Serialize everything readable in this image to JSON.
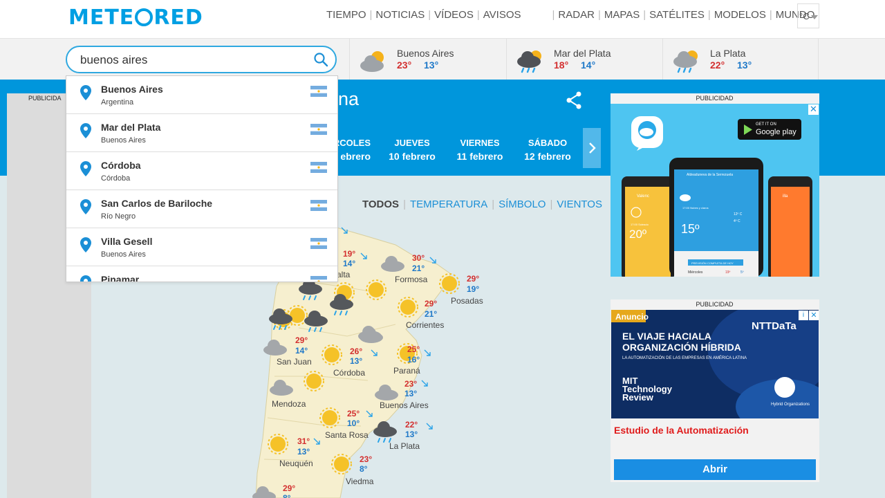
{
  "header": {
    "logo_text": "METEORED",
    "nav": [
      "TIEMPO",
      "NOTICIAS",
      "VÍDEOS",
      "AVISOS",
      "RADAR",
      "MAPAS",
      "SATÉLITES",
      "MODELOS",
      "MUNDO"
    ],
    "unit": "°C"
  },
  "search": {
    "value": "buenos aires"
  },
  "quick_cities": [
    {
      "name": "Buenos Aires",
      "max": "23°",
      "min": "13°",
      "icon": "partly-cloudy-icon"
    },
    {
      "name": "Mar del Plata",
      "max": "18°",
      "min": "14°",
      "icon": "rain-cloud-icon"
    },
    {
      "name": "La Plata",
      "max": "22°",
      "min": "13°",
      "icon": "rain-cloud-icon"
    }
  ],
  "band": {
    "title_fragment": "na",
    "days": [
      {
        "name": "RCOLES",
        "date": "ebrero"
      },
      {
        "name": "JUEVES",
        "date": "10 febrero"
      },
      {
        "name": "VIERNES",
        "date": "11 febrero"
      },
      {
        "name": "SÁBADO",
        "date": "12 febrero"
      }
    ]
  },
  "left_ad_label": "PUBLICIDA",
  "suggestions": [
    {
      "city": "Buenos Aires",
      "region": "Argentina"
    },
    {
      "city": "Mar del Plata",
      "region": "Buenos Aires"
    },
    {
      "city": "Córdoba",
      "region": "Córdoba"
    },
    {
      "city": "San Carlos de Bariloche",
      "region": "Río Negro"
    },
    {
      "city": "Villa Gesell",
      "region": "Buenos Aires"
    },
    {
      "city": "Pinamar",
      "region": ""
    }
  ],
  "filters": [
    "TODOS",
    "TEMPERATURA",
    "SÍMBOLO",
    "VIENTOS"
  ],
  "map_cities": [
    {
      "name": "alta",
      "max": "19°",
      "min": "14°"
    },
    {
      "name": "Formosa",
      "max": "30°",
      "min": "21°"
    },
    {
      "name": "Posadas",
      "max": "29°",
      "min": "19°"
    },
    {
      "name": "Corrientes",
      "max": "29°",
      "min": "21°"
    },
    {
      "name": "San Juan",
      "max": "29°",
      "min": "14°"
    },
    {
      "name": "Córdoba",
      "max": "26°",
      "min": "13°"
    },
    {
      "name": "Paraná",
      "max": "25°",
      "min": "16°"
    },
    {
      "name": "Mendoza",
      "max": "",
      "min": ""
    },
    {
      "name": "Buenos Aires",
      "max": "23°",
      "min": "13°"
    },
    {
      "name": "Santa Rosa",
      "max": "25°",
      "min": "10°"
    },
    {
      "name": "La Plata",
      "max": "22°",
      "min": "13°"
    },
    {
      "name": "Neuquén",
      "max": "31°",
      "min": "13°"
    },
    {
      "name": "Viedma",
      "max": "23°",
      "min": "8°"
    },
    {
      "name": "",
      "max": "29°",
      "min": "8°"
    }
  ],
  "ads": {
    "label": "PUBLICIDAD",
    "ad1_badge_small": "GET IT ON",
    "ad1_badge": "Google play",
    "ad1_phone_location": "Aldeaduneva de la Serrezuela",
    "ad1_temp": "15º",
    "ad1_temp_left": "20º",
    "ad1_side_temps": [
      "12º C",
      "4º C"
    ],
    "ad1_tab_left": "Valenc",
    "ad1_tab_right": "illa",
    "ad1_forecast_bar": "PREVISIÓN COMPLETA DE HOY",
    "ad1_row": [
      "Miércoles",
      "19º",
      "5º"
    ],
    "ad1_left_sub": "17:00 Soleado",
    "ad1_center_sub": "17:00 Nubes y claros",
    "ad2_badge": "Anuncio",
    "ad2_brand": "NTTDaTa",
    "ad2_headline_img": "EL VIAJE HACIALA ORGANIZACIÓN HÍBRIDA",
    "ad2_subline": "LA AUTOMATIZACIÓN DE LAS EMPRESAS EN AMÉRICA LATINA",
    "ad2_mit": "MIT Technology Review",
    "ad2_hybrid": "Hybrid Organizations",
    "ad2_headline": "Estudio de la Automatización",
    "ad2_cta": "Abrir"
  },
  "colors": {
    "brand": "#009fe3",
    "band": "#0096dc",
    "max": "#d32f2f",
    "min": "#1e78c8"
  }
}
